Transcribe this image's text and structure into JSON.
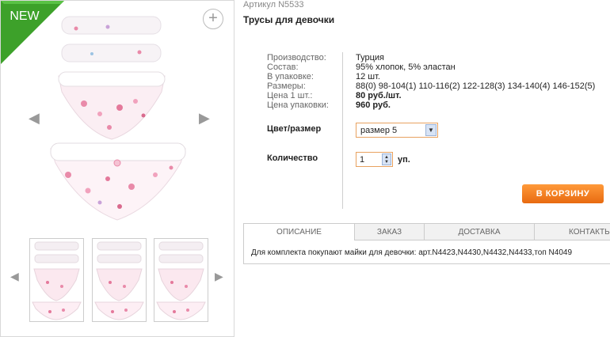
{
  "gallery": {
    "badge": "NEW",
    "zoom_icon": "plus-icon",
    "prev_icon": "chevron-left-icon",
    "next_icon": "chevron-right-icon",
    "thumbnails_count": 3
  },
  "product": {
    "article": "Артикул N5533",
    "title": "Трусы для девочки",
    "specs": [
      {
        "label": "Производство:",
        "value": "Турция",
        "bold": false
      },
      {
        "label": "Состав:",
        "value": "95% хлопок, 5% эластан",
        "bold": false
      },
      {
        "label": "В упаковке:",
        "value": "12 шт.",
        "bold": false
      },
      {
        "label": "Размеры:",
        "value": "88(0) 98-104(1) 110-116(2) 122-128(3) 134-140(4) 146-152(5)",
        "bold": false
      },
      {
        "label": "Цена 1 шт.:",
        "value": "80 руб./шт.",
        "bold": true
      },
      {
        "label": "Цена упаковки:",
        "value": "960 руб.",
        "bold": true
      }
    ]
  },
  "options": {
    "color_size_label": "Цвет/размер",
    "color_size_value": "размер 5",
    "quantity_label": "Количество",
    "quantity_value": "1",
    "quantity_unit": "уп."
  },
  "cart_button": "В КОРЗИНУ",
  "tabs": [
    {
      "label": "ОПИСАНИЕ",
      "active": true
    },
    {
      "label": "ЗАКАЗ",
      "active": false
    },
    {
      "label": "ДОСТАВКА",
      "active": false
    },
    {
      "label": "КОНТАКТЫ",
      "active": false
    }
  ],
  "description": "Для комплекта покупают майки для девочки: арт.N4423,N4430,N4432,N4433,топ N4049",
  "colors": {
    "ribbon": "#3da12a",
    "cart_button": "#f07b1c",
    "field_border": "#e8a260"
  }
}
